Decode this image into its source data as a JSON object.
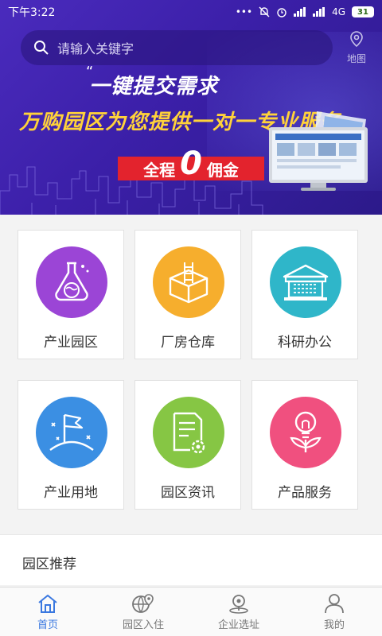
{
  "status": {
    "time": "下午3:22",
    "network": "4G",
    "battery": "31"
  },
  "search": {
    "placeholder": "请输入关键字"
  },
  "map_button": {
    "label": "地图"
  },
  "banner": {
    "headline": "一键提交需求",
    "subline": "万购园区为您提供一对一专业服务",
    "commission_left": "全程",
    "commission_zero": "0",
    "commission_right": "佣金"
  },
  "categories": [
    {
      "label": "产业园区",
      "color": "#9b45d6",
      "icon": "flask-globe-icon"
    },
    {
      "label": "厂房仓库",
      "color": "#f6ae2d",
      "icon": "warehouse-box-icon"
    },
    {
      "label": "科研办公",
      "color": "#2fb6c9",
      "icon": "office-building-icon"
    },
    {
      "label": "产业用地",
      "color": "#3b8fe3",
      "icon": "flag-land-icon"
    },
    {
      "label": "园区资讯",
      "color": "#86c644",
      "icon": "news-document-icon"
    },
    {
      "label": "产品服务",
      "color": "#f0507f",
      "icon": "lightbulb-plant-icon"
    }
  ],
  "section": {
    "title": "园区推荐"
  },
  "nav": [
    {
      "label": "首页",
      "icon": "home-icon",
      "active": true
    },
    {
      "label": "园区入住",
      "icon": "globe-pin-icon",
      "active": false
    },
    {
      "label": "企业选址",
      "icon": "search-location-icon",
      "active": false
    },
    {
      "label": "我的",
      "icon": "user-icon",
      "active": false
    }
  ]
}
